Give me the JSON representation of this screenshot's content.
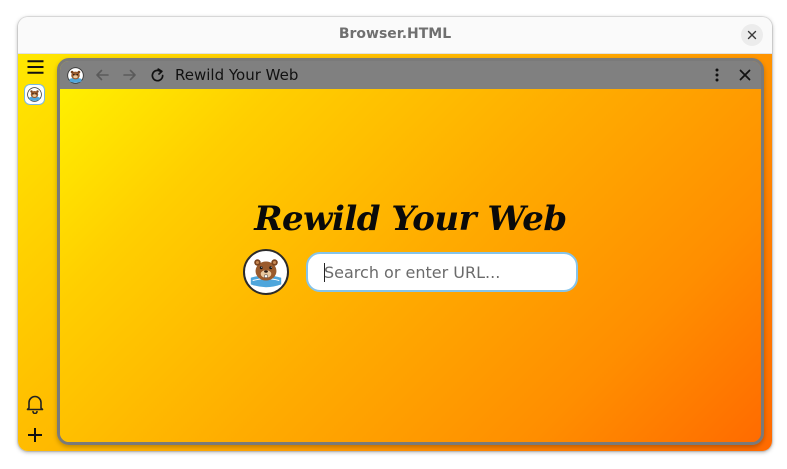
{
  "window": {
    "title": "Browser.HTML"
  },
  "sidebar": {
    "menu_icon": "menu-icon",
    "tab_icon": "beaver-favicon-icon",
    "bell_icon": "bell-icon",
    "add_icon": "plus-icon"
  },
  "browser": {
    "tab_title": "Rewild Your Web",
    "icons": [
      "beaver-favicon-icon",
      "back-arrow-icon",
      "forward-arrow-icon",
      "reload-icon",
      "kebab-menu-icon",
      "close-icon"
    ]
  },
  "page": {
    "heading": "Rewild Your Web",
    "search_placeholder": "Search or enter URL..."
  },
  "colors": {
    "gradient_start": "#fff000",
    "gradient_end": "#ff6b00",
    "toolbar": "#808080",
    "input_border": "#86c4ea"
  }
}
